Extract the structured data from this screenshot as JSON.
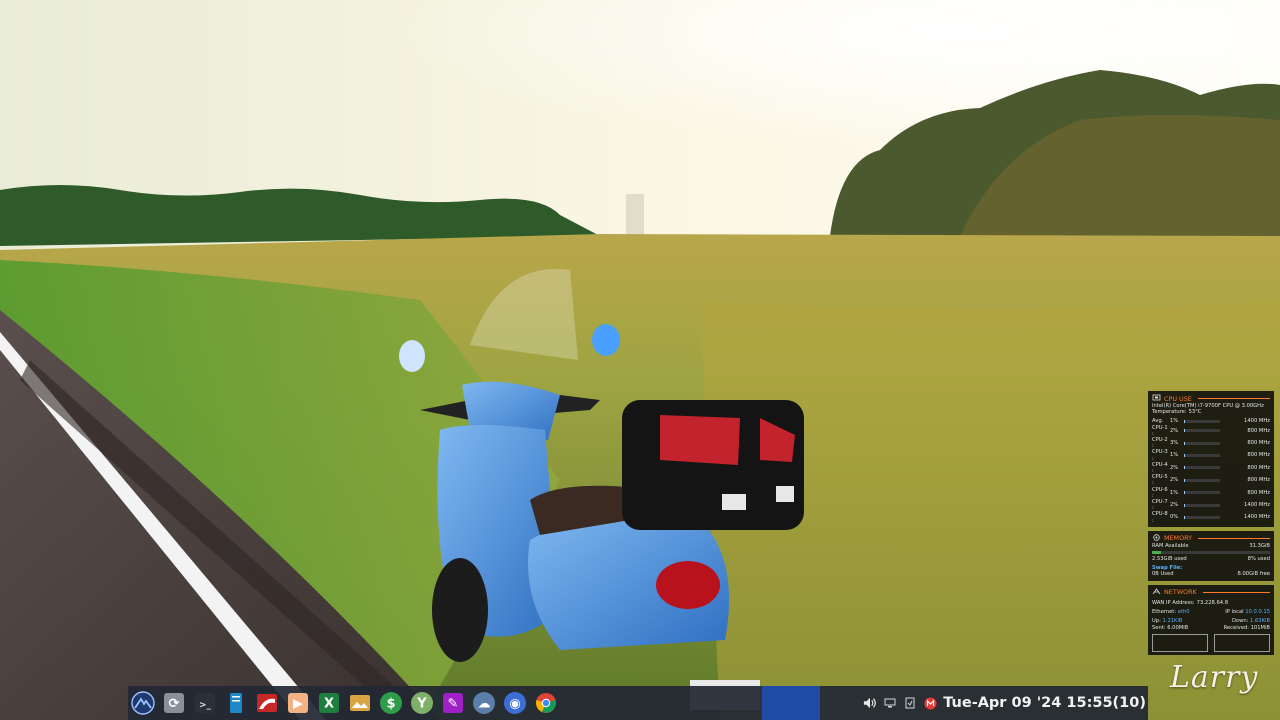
{
  "desktop": {
    "signature": "Larry"
  },
  "conky": {
    "cpu": {
      "header": "CPU USE",
      "model": "Intel(R) Core(TM) i7-9700F CPU @ 3.00GHz",
      "temperature_label": "Temperature:",
      "temperature": "53°C",
      "rows": [
        {
          "label": "Avg.",
          "pct": "1%",
          "level": 0.01,
          "freq": "1400 MHz"
        },
        {
          "label": "CPU-1 :",
          "pct": "2%",
          "level": 0.02,
          "freq": "800 MHz"
        },
        {
          "label": "CPU-2 :",
          "pct": "3%",
          "level": 0.03,
          "freq": "800 MHz"
        },
        {
          "label": "CPU-3 :",
          "pct": "1%",
          "level": 0.01,
          "freq": "800 MHz"
        },
        {
          "label": "CPU-4 :",
          "pct": "2%",
          "level": 0.02,
          "freq": "800 MHz"
        },
        {
          "label": "CPU-5 :",
          "pct": "2%",
          "level": 0.02,
          "freq": "800 MHz"
        },
        {
          "label": "CPU-6 :",
          "pct": "1%",
          "level": 0.01,
          "freq": "800 MHz"
        },
        {
          "label": "CPU-7 :",
          "pct": "2%",
          "level": 0.02,
          "freq": "1400 MHz"
        },
        {
          "label": "CPU-8 :",
          "pct": "0%",
          "level": 0.0,
          "freq": "1400 MHz"
        }
      ]
    },
    "memory": {
      "header": "MEMORY",
      "ram_label": "RAM Available",
      "ram_total": "31.3GiB",
      "used": "2.53GiB used",
      "used_pct": "8% used",
      "level": 0.08,
      "swap_label": "Swap File:",
      "swap_used": "0B Used",
      "swap_free": "8.00GiB free"
    },
    "network": {
      "header": "NETWORK",
      "wan_label": "WAN IP Address:",
      "wan_ip": "73.228.64.8",
      "ethernet_label": "Ethernet:",
      "ethernet_iface": "eth0",
      "ip_local_label": "IP local",
      "ip_local": "10.0.0.15",
      "up_label": "Up:",
      "up_rate": "1.21KiB",
      "down_label": "Down:",
      "down_rate": "1.63KiB",
      "sent_label": "Sent:",
      "sent": "6.00MiB",
      "received_label": "Received:",
      "received": "101MiB"
    }
  },
  "taskbar": {
    "clock": "Tue-Apr 09 '24 15:55(10)",
    "launchers": [
      {
        "name": "mx-menu-icon",
        "glyph": "",
        "bg": "#1e3a6e",
        "fg": "#9cc2ff"
      },
      {
        "name": "refresh-icon",
        "glyph": "⟳",
        "bg": "#8a8f99",
        "fg": "#ffffff"
      },
      {
        "name": "terminal-icon",
        "glyph": ">_",
        "bg": "#2a2f38",
        "fg": "#dfe6ee"
      },
      {
        "name": "file-manager-icon",
        "glyph": "",
        "bg": "#1e88c8",
        "fg": "#ffffff"
      },
      {
        "name": "red-app-icon",
        "glyph": "",
        "bg": "#c62828",
        "fg": "#ffffff"
      },
      {
        "name": "media-player-icon",
        "glyph": "▶",
        "bg": "#f4b183",
        "fg": "#ffffff"
      },
      {
        "name": "spreadsheet-icon",
        "glyph": "X",
        "bg": "#1e7e3e",
        "fg": "#ffffff"
      },
      {
        "name": "photo-viewer-icon",
        "glyph": "",
        "bg": "#d9a441",
        "fg": "#ffffff"
      },
      {
        "name": "money-manager-icon",
        "glyph": "$",
        "bg": "#2e9d4a",
        "fg": "#ffffff"
      },
      {
        "name": "tools-icon",
        "glyph": "Y",
        "bg": "#7fb069",
        "fg": "#ffffff"
      },
      {
        "name": "text-editor-icon",
        "glyph": "✎",
        "bg": "#a020c8",
        "fg": "#ffffff"
      },
      {
        "name": "weather-icon",
        "glyph": "☁",
        "bg": "#5b7fa8",
        "fg": "#ffffff"
      },
      {
        "name": "browser-icon",
        "glyph": "◉",
        "bg": "#3b6fd6",
        "fg": "#ffffff"
      },
      {
        "name": "chrome-icon",
        "glyph": "",
        "bg": "#e8e8e8",
        "fg": "#db4437"
      }
    ]
  },
  "colors": {
    "accent": "#ff7a2a",
    "panel_bg": "#0a0a0c",
    "taskbar_bg": "#222834",
    "active_task": "#1f4fb0"
  }
}
